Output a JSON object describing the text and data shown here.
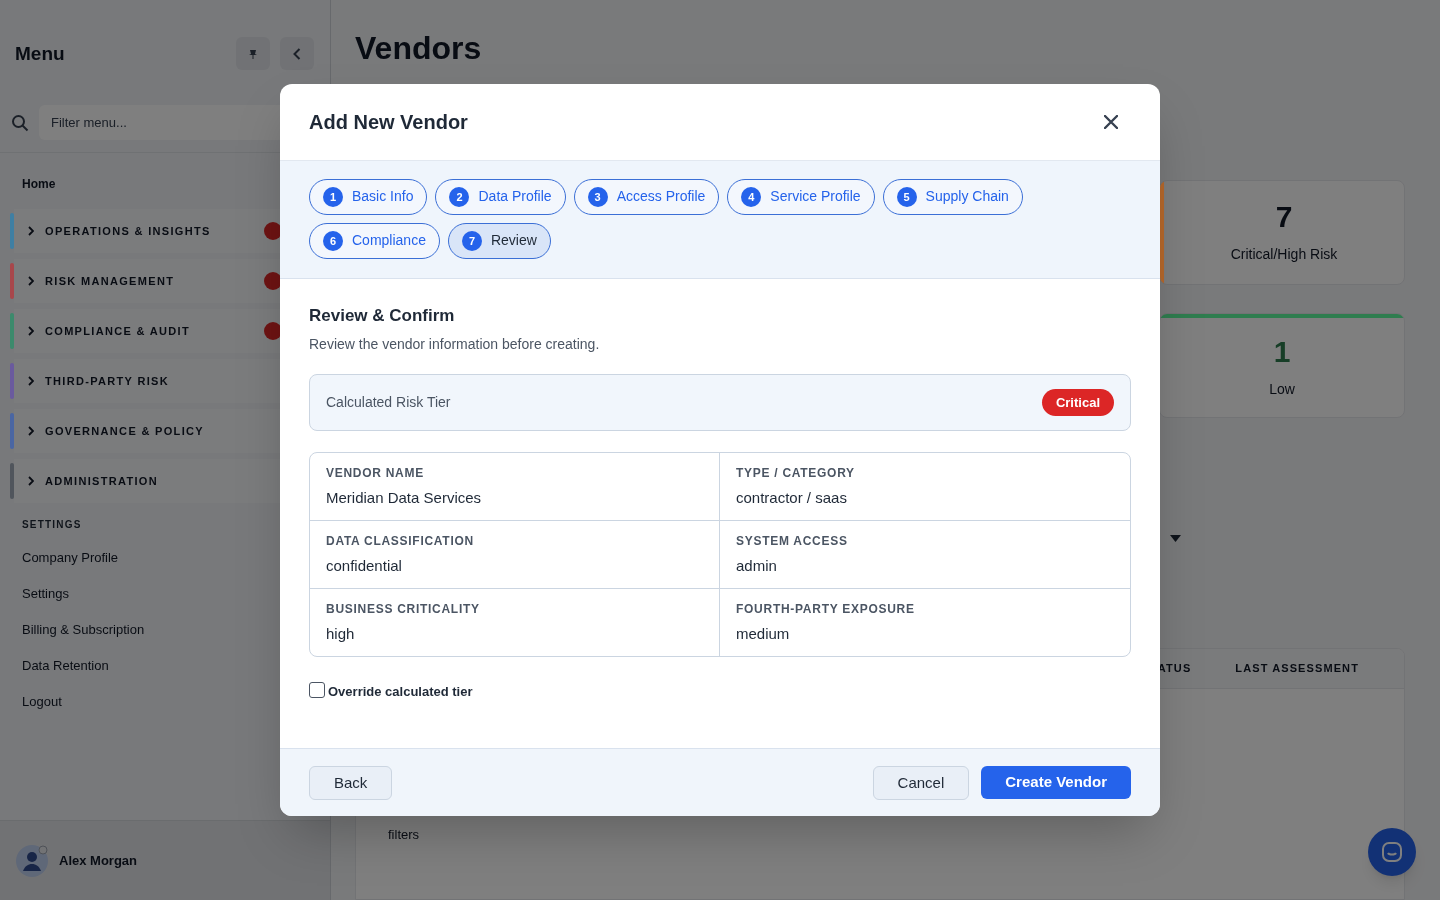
{
  "sidebar": {
    "title": "Menu",
    "search": {
      "placeholder": "Filter menu..."
    },
    "home": "Home",
    "sections": [
      {
        "label": "OPERATIONS & INSIGHTS",
        "color": "#3f7fa3",
        "expanded": false,
        "badge": true
      },
      {
        "label": "RISK MANAGEMENT",
        "color": "#a8474b",
        "expanded": false,
        "badge": true
      },
      {
        "label": "COMPLIANCE & AUDIT",
        "color": "#3c8a6c",
        "expanded": false,
        "badge": true
      },
      {
        "label": "THIRD-PARTY RISK",
        "color": "#6a5a9e",
        "expanded": false,
        "badge": false
      },
      {
        "label": "GOVERNANCE & POLICY",
        "color": "#4a66a3",
        "expanded": false,
        "badge": false
      },
      {
        "label": "ADMINISTRATION",
        "color": "#50555c",
        "expanded": false,
        "badge": false
      }
    ],
    "settings_heading": "SETTINGS",
    "links": [
      "Company Profile",
      "Settings",
      "Billing & Subscription",
      "Data Retention",
      "Logout"
    ],
    "user": {
      "name": "Alex Morgan"
    }
  },
  "page": {
    "title": "Vendors",
    "stats": [
      {
        "value": "7",
        "label": "Critical/High Risk",
        "kind": "left",
        "color": "#b8692c"
      },
      {
        "value": "1",
        "label": "Low",
        "kind": "top",
        "color": "#2f7d4f"
      }
    ],
    "table": {
      "columns": [
        "ATUS",
        "LAST ASSESSMENT"
      ],
      "empty_text": "filters"
    }
  },
  "modal": {
    "title": "Add New Vendor",
    "steps": [
      {
        "number": "1",
        "label": "Basic Info",
        "selected": false
      },
      {
        "number": "2",
        "label": "Data Profile",
        "selected": false
      },
      {
        "number": "3",
        "label": "Access Profile",
        "selected": false
      },
      {
        "number": "4",
        "label": "Service Profile",
        "selected": false
      },
      {
        "number": "5",
        "label": "Supply Chain",
        "selected": false
      },
      {
        "number": "6",
        "label": "Compliance",
        "selected": false
      },
      {
        "number": "7",
        "label": "Review",
        "selected": true
      }
    ],
    "section": {
      "title": "Review & Confirm",
      "subtitle": "Review the vendor information before creating."
    },
    "risk_tier": {
      "label": "Calculated Risk Tier",
      "value": "Critical"
    },
    "fields": [
      {
        "label": "VENDOR NAME",
        "value": "Meridian Data Services"
      },
      {
        "label": "TYPE / CATEGORY",
        "value": "contractor / saas"
      },
      {
        "label": "DATA CLASSIFICATION",
        "value": "confidential"
      },
      {
        "label": "SYSTEM ACCESS",
        "value": "admin"
      },
      {
        "label": "BUSINESS CRITICALITY",
        "value": "high"
      },
      {
        "label": "FOURTH-PARTY EXPOSURE",
        "value": "medium"
      }
    ],
    "override": {
      "label": "Override calculated tier",
      "checked": false
    },
    "buttons": {
      "back": "Back",
      "cancel": "Cancel",
      "submit": "Create Vendor"
    }
  }
}
